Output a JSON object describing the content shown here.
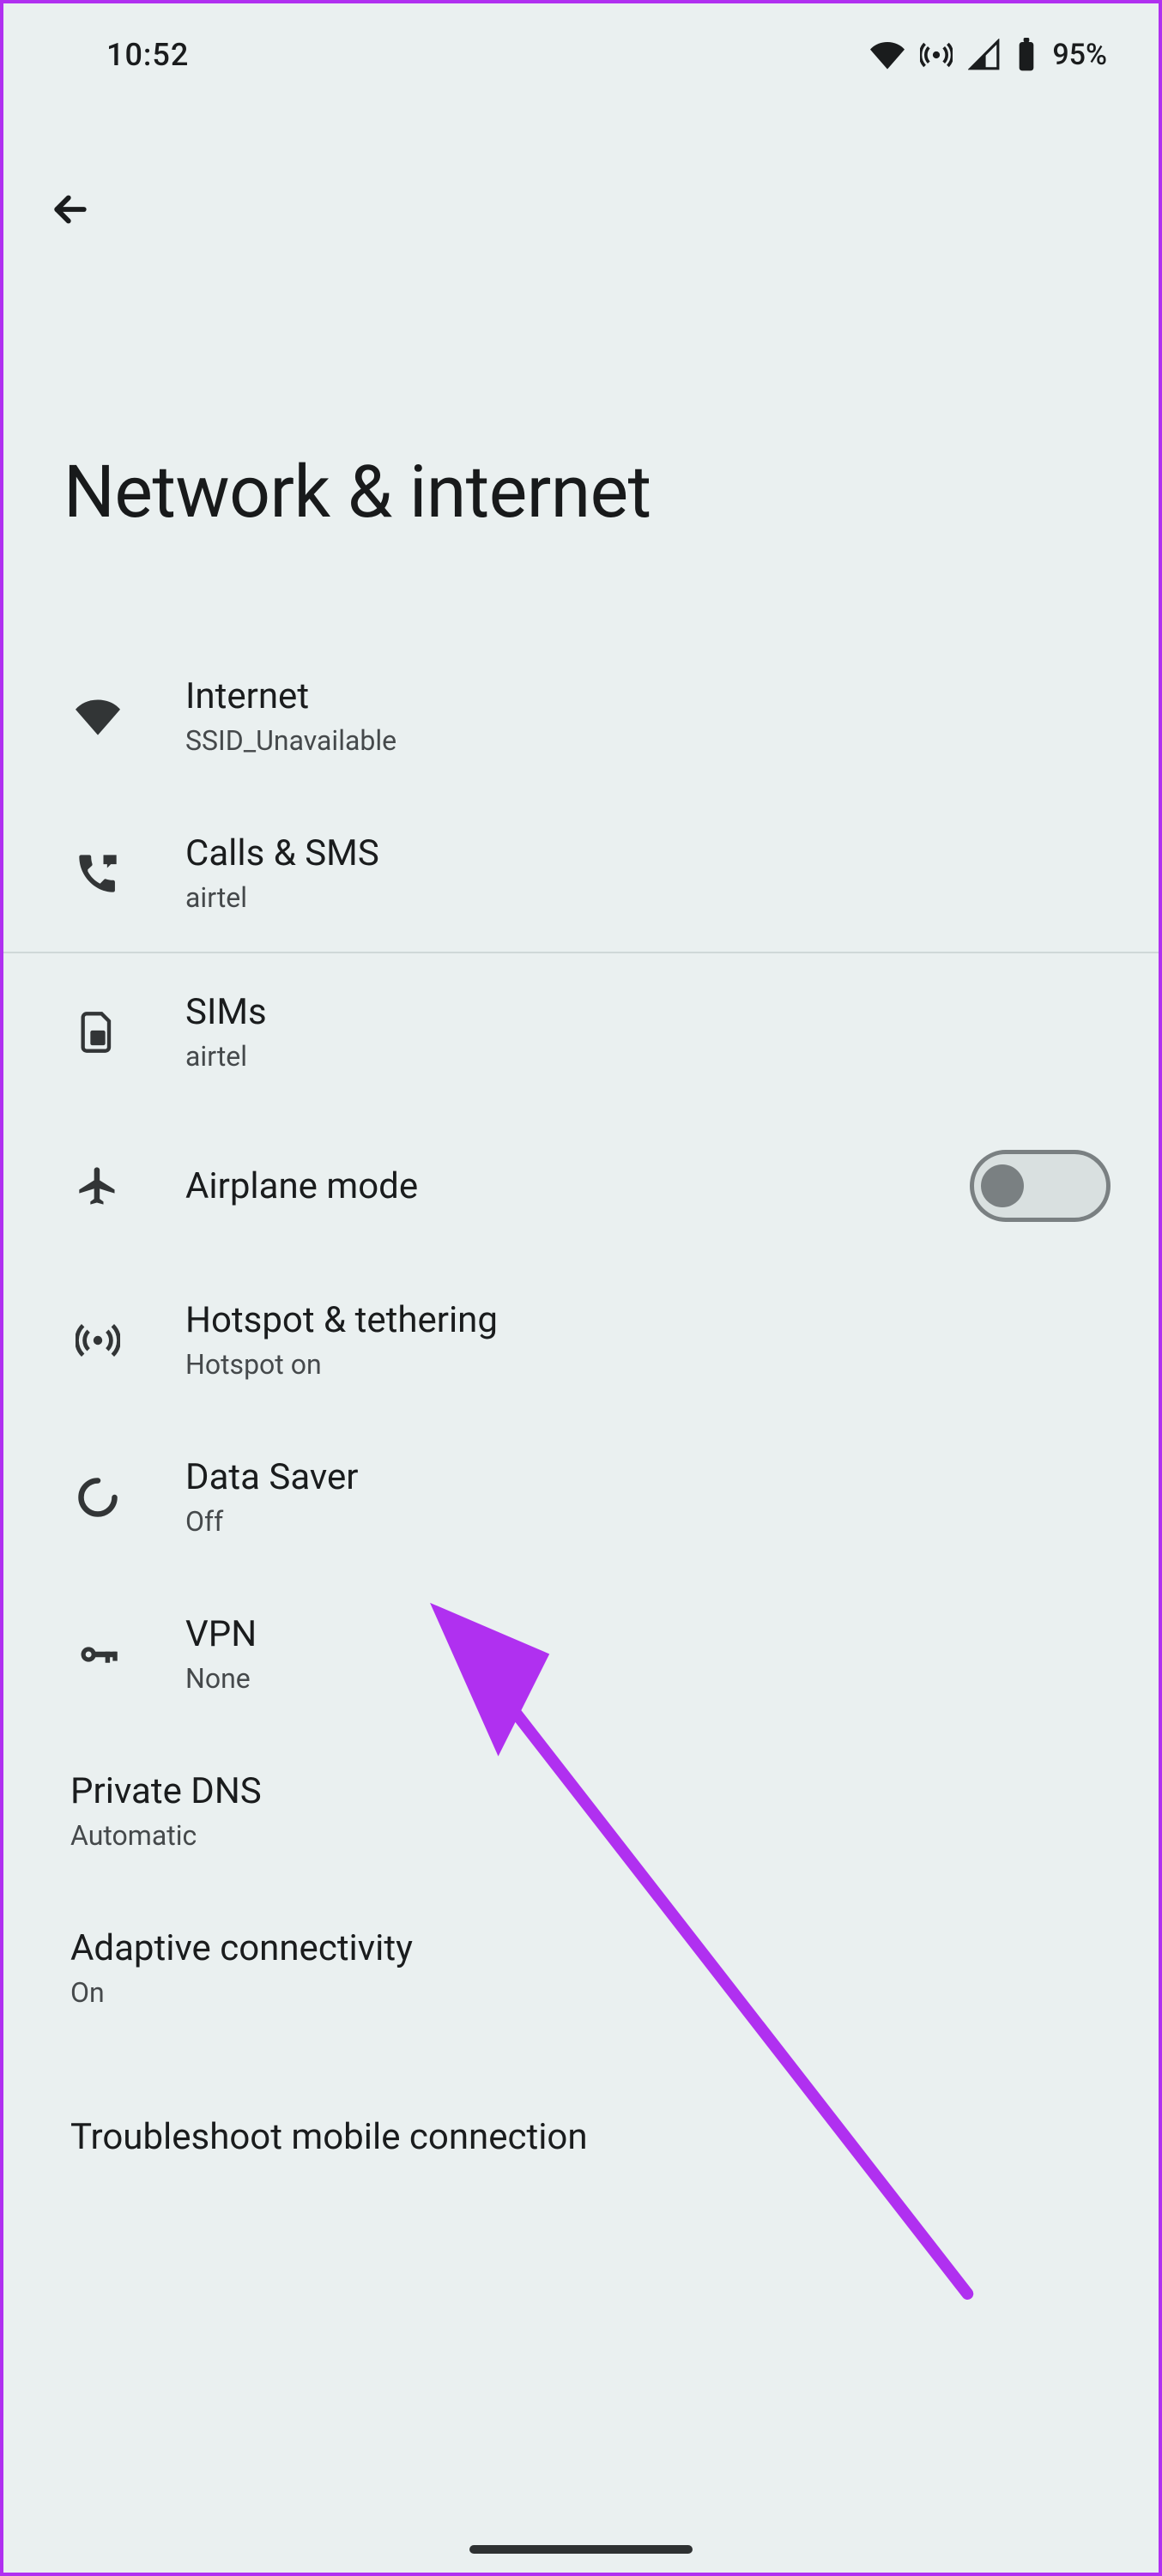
{
  "statusbar": {
    "time": "10:52",
    "battery_text": "95%"
  },
  "header": {
    "title": "Network & internet"
  },
  "items": [
    {
      "title": "Internet",
      "sub": "SSID_Unavailable"
    },
    {
      "title": "Calls & SMS",
      "sub": "airtel"
    },
    {
      "title": "SIMs",
      "sub": "airtel"
    },
    {
      "title": "Airplane mode",
      "sub": ""
    },
    {
      "title": "Hotspot & tethering",
      "sub": "Hotspot on"
    },
    {
      "title": "Data Saver",
      "sub": "Off"
    },
    {
      "title": "VPN",
      "sub": "None"
    },
    {
      "title": "Private DNS",
      "sub": "Automatic"
    },
    {
      "title": "Adaptive connectivity",
      "sub": "On"
    },
    {
      "title": "Troubleshoot mobile connection",
      "sub": ""
    }
  ],
  "airplane_mode_on": false
}
